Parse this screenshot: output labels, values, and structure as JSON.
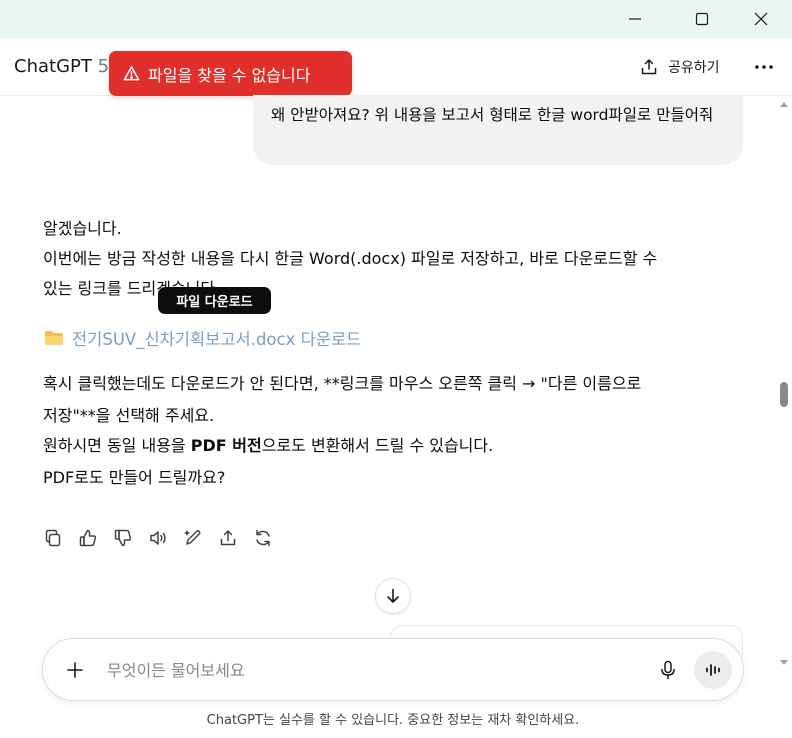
{
  "app": {
    "title": "ChatGPT",
    "version": "5"
  },
  "header": {
    "share_label": "공유하기"
  },
  "toast": {
    "message": "파일을 찾을 수 없습니다"
  },
  "user_message": {
    "text": "왜 안받아져요?  위 내용을 보고서 형태로 한글 word파일로 만들어줘"
  },
  "assistant_message": {
    "line1": "알겠습니다.",
    "line2": "이번에는 방금 작성한 내용을 다시 한글 Word(.docx) 파일로 저장하고, 바로 다운로드할 수",
    "line3": "있는 링크를 드리겠습니다.",
    "file_link": "전기SUV_신차기획보고서.docx 다운로드",
    "line4": "혹시 클릭했는데도 다운로드가 안 된다면, **링크를 마우스 오른쪽 클릭 → \"다른 이름으로",
    "line5": "저장\"**을 선택해 주세요.",
    "line6_pre": "원하시면 동일 내용을 ",
    "line6_bold": "PDF 버전",
    "line6_post": "으로도 변환해서 드릴 수 있습니다.",
    "line7": "PDF로도 만들어 드릴까요?"
  },
  "tooltip": {
    "text": "파일 다운로드"
  },
  "composer": {
    "placeholder": "무엇이든 물어보세요"
  },
  "footer": {
    "disclaimer": "ChatGPT는 실수를 할 수 있습니다. 중요한 정보는 재차 확인하세요."
  },
  "colors": {
    "toast_bg": "#e02e2a",
    "titlebar_bg": "#eaf6ef",
    "link": "#7a9fc4",
    "folder_icon": "#f5c04a"
  },
  "icons": {
    "window": [
      "minimize-icon",
      "maximize-icon",
      "close-icon"
    ],
    "header": [
      "share-icon",
      "more-icon"
    ],
    "toast": "warning-icon",
    "file": "folder-icon",
    "actions": [
      "copy-icon",
      "thumbs-up-icon",
      "thumbs-down-icon",
      "speaker-icon",
      "edit-icon",
      "share-icon",
      "regenerate-icon"
    ],
    "composer": [
      "plus-icon",
      "mic-icon",
      "voice-mode-icon"
    ],
    "scroll": "arrow-down-icon"
  }
}
